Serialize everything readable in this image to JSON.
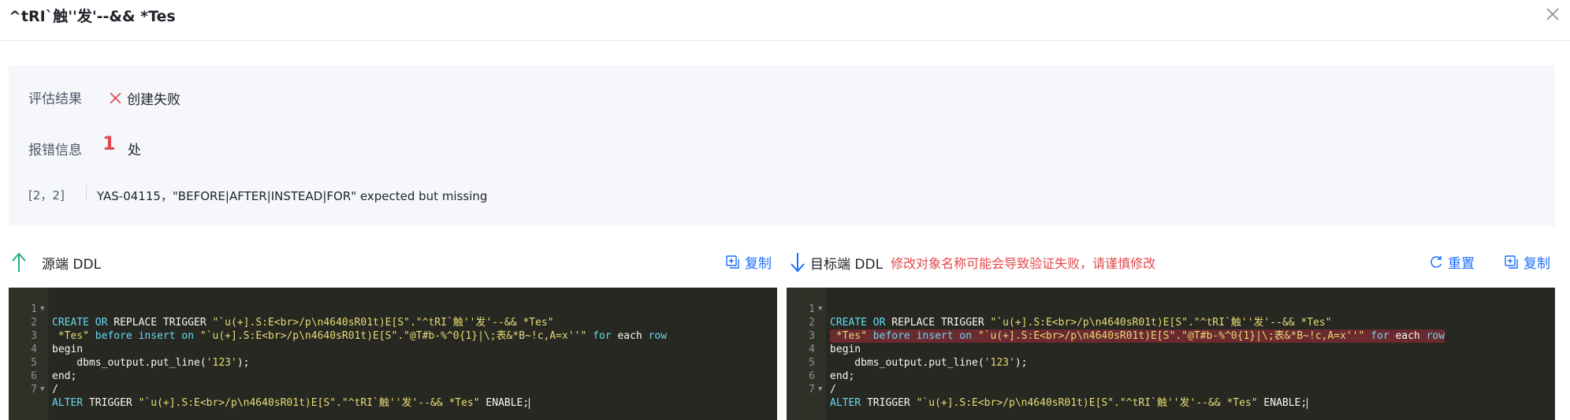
{
  "title": "^tRI`触''发'--&& *Tes",
  "result": {
    "label": "评估结果",
    "status_text": "创建失败",
    "error_label": "报错信息",
    "error_count": "1",
    "error_unit": "处",
    "error_position": "[2，2]",
    "error_message": "YAS-04115，\"BEFORE|AFTER|INSTEAD|FOR\" expected but missing"
  },
  "source": {
    "title": "源端 DDL",
    "copy_label": "复制",
    "lines": [
      {
        "num": "1",
        "fold": true
      },
      {
        "num": "2"
      },
      {
        "num": "3"
      },
      {
        "num": "4"
      },
      {
        "num": "5"
      },
      {
        "num": "6"
      },
      {
        "num": "7",
        "fold": true
      }
    ]
  },
  "target": {
    "title": "目标端 DDL",
    "warning": "修改对象名称可能会导致验证失败，请谨慎修改",
    "reset_label": "重置",
    "copy_label": "复制",
    "highlight_line": 2
  },
  "code": {
    "l1_kw1": "CREATE",
    "l1_kw2": "OR",
    "l1_kw3": "REPLACE",
    "l1_kw4": "TRIGGER",
    "l1_str": "\"`u(+].S:E<br>/p\\n4640sR01t)E[S\".\"^tRI`触''发'--&& *Tes\"",
    "l2_str": " *Tes\"",
    "l2_kw1": "before",
    "l2_kw2": "insert",
    "l2_kw3": "on",
    "l2_str2": "\"`u(+].S:E<br>/p\\n4640sR01t)E[S\".\"@T#b-%^0{1}|\\;表&*B~!c,A=x''\"",
    "l2_kw4": "for",
    "l2_t1": "each",
    "l2_kw5": "row",
    "l3": "begin",
    "l4_fn": "    dbms_output.put_line(",
    "l4_str": "'123'",
    "l4_end": ");",
    "l5": "end;",
    "l6": "/",
    "l7_kw1": "ALTER",
    "l7_kw2": "TRIGGER",
    "l7_str": "\"`u(+].S:E<br>/p\\n4640sR01t)E[S\".\"^tRI`触''发'--&& *Tes\"",
    "l7_t": "ENABLE;"
  },
  "colors": {
    "accent": "#1a6dff",
    "error": "#e5484d",
    "success_icon": "#18a058",
    "editor_bg": "#272822"
  }
}
